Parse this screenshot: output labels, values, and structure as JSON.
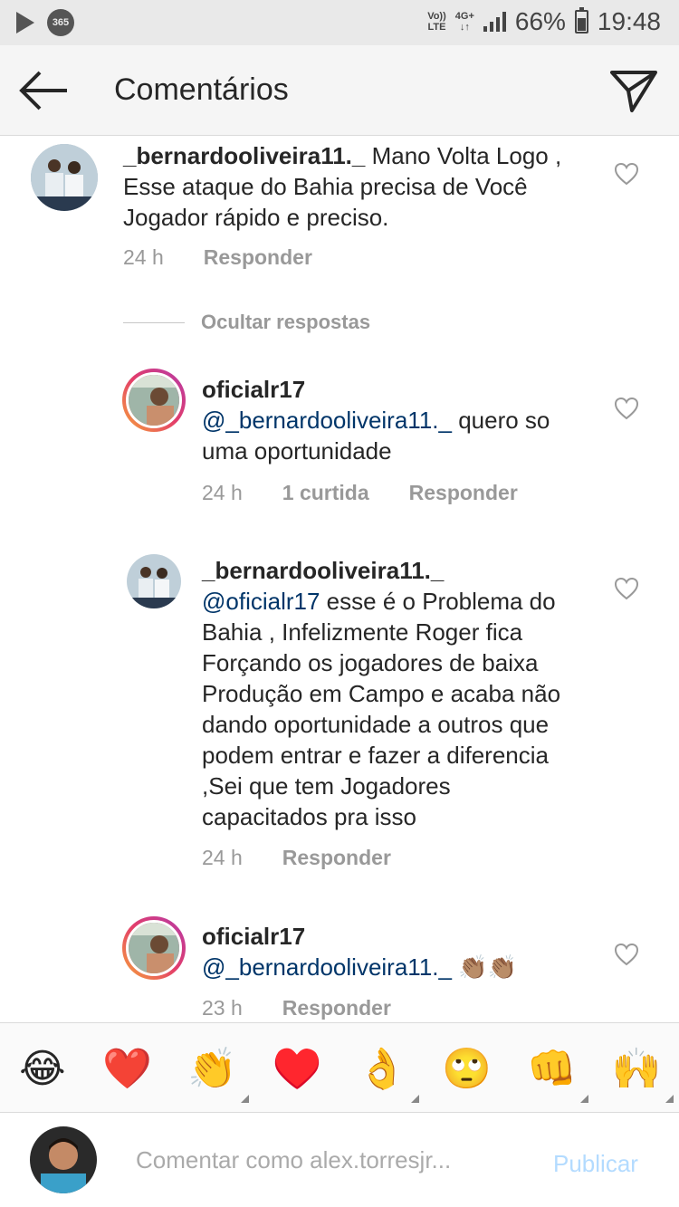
{
  "status_bar": {
    "app_icon_365": "365",
    "volte_top": "Vo))",
    "volte_bottom": "LTE",
    "network_top": "4G+",
    "network_bottom": "↓↑",
    "battery": "66%",
    "time": "19:48"
  },
  "header": {
    "title": "Comentários"
  },
  "comments": [
    {
      "username": "_bernardooliveira11._",
      "text": " Mano Volta Logo , Esse ataque do Bahia precisa de Você Jogador rápido e preciso.",
      "time": "24 h",
      "reply_label": "Responder"
    }
  ],
  "hide_replies_label": "Ocultar respostas",
  "replies": [
    {
      "username": "oficialr17",
      "mention": "@_bernardooliveira11._",
      "text": "  quero so uma oportunidade",
      "time": "24 h",
      "likes": "1 curtida",
      "reply_label": "Responder"
    },
    {
      "username": "_bernardooliveira11._",
      "mention": "@oficialr17",
      "text": " esse é o Problema do Bahia , Infelizmente Roger fica Forçando os jogadores de baixa Produção em Campo e acaba não dando oportunidade a outros que podem entrar e fazer a diferencia ,Sei que tem Jogadores capacitados pra isso",
      "time": "24 h",
      "reply_label": "Responder"
    },
    {
      "username": "oficialr17",
      "mention": "@_bernardooliveira11._",
      "text": " 👏🏽👏🏽",
      "time": "23 h",
      "reply_label": "Responder"
    }
  ],
  "emoji_bar": [
    "😂",
    "❤️",
    "👏",
    "♥️",
    "👌",
    "🙄",
    "👊",
    "🙌"
  ],
  "composer": {
    "placeholder": "Comentar como alex.torresjr...",
    "publish_label": "Publicar"
  },
  "colors": {
    "mention": "#003569",
    "publish_disabled": "#b3dbff",
    "header_bg": "#f5f5f5",
    "status_bg": "#e9e9e9"
  }
}
